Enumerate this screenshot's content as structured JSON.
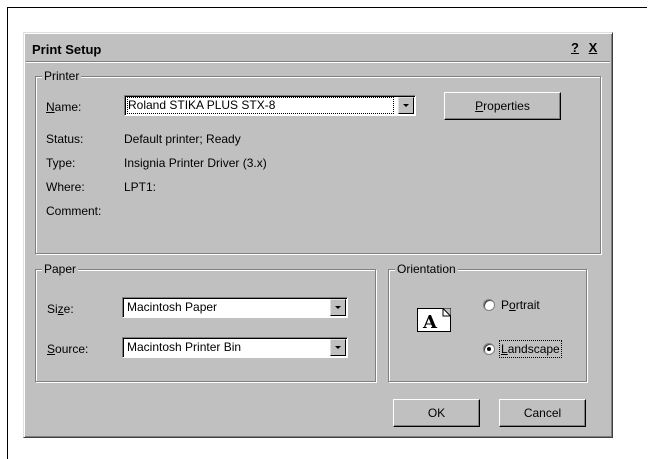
{
  "dialog": {
    "title": "Print Setup",
    "help_glyph": "?",
    "close_glyph": "X"
  },
  "printer": {
    "group_label": "Printer",
    "name_label_prefix": "",
    "name_label_accel": "N",
    "name_label_rest": "ame:",
    "name_value": "Roland STIKA PLUS STX-8",
    "properties_accel": "P",
    "properties_rest": "roperties",
    "status_label": "Status:",
    "status_value": "Default printer; Ready",
    "type_label": "Type:",
    "type_value": "Insignia Printer Driver (3.x)",
    "where_label": "Where:",
    "where_value": "LPT1:",
    "comment_label": "Comment:",
    "comment_value": ""
  },
  "paper": {
    "group_label": "Paper",
    "size_label_pre": "Si",
    "size_label_accel": "z",
    "size_label_post": "e:",
    "size_value": "Macintosh Paper",
    "source_label_accel": "S",
    "source_label_rest": "ource:",
    "source_value": "Macintosh Printer Bin"
  },
  "orientation": {
    "group_label": "Orientation",
    "icon_letter": "A",
    "portrait_pre": "P",
    "portrait_accel": "o",
    "portrait_post": "rtrait",
    "landscape_accel": "L",
    "landscape_rest": "andscape",
    "selected": "Landscape"
  },
  "buttons": {
    "ok_label": "OK",
    "cancel_label": "Cancel"
  }
}
